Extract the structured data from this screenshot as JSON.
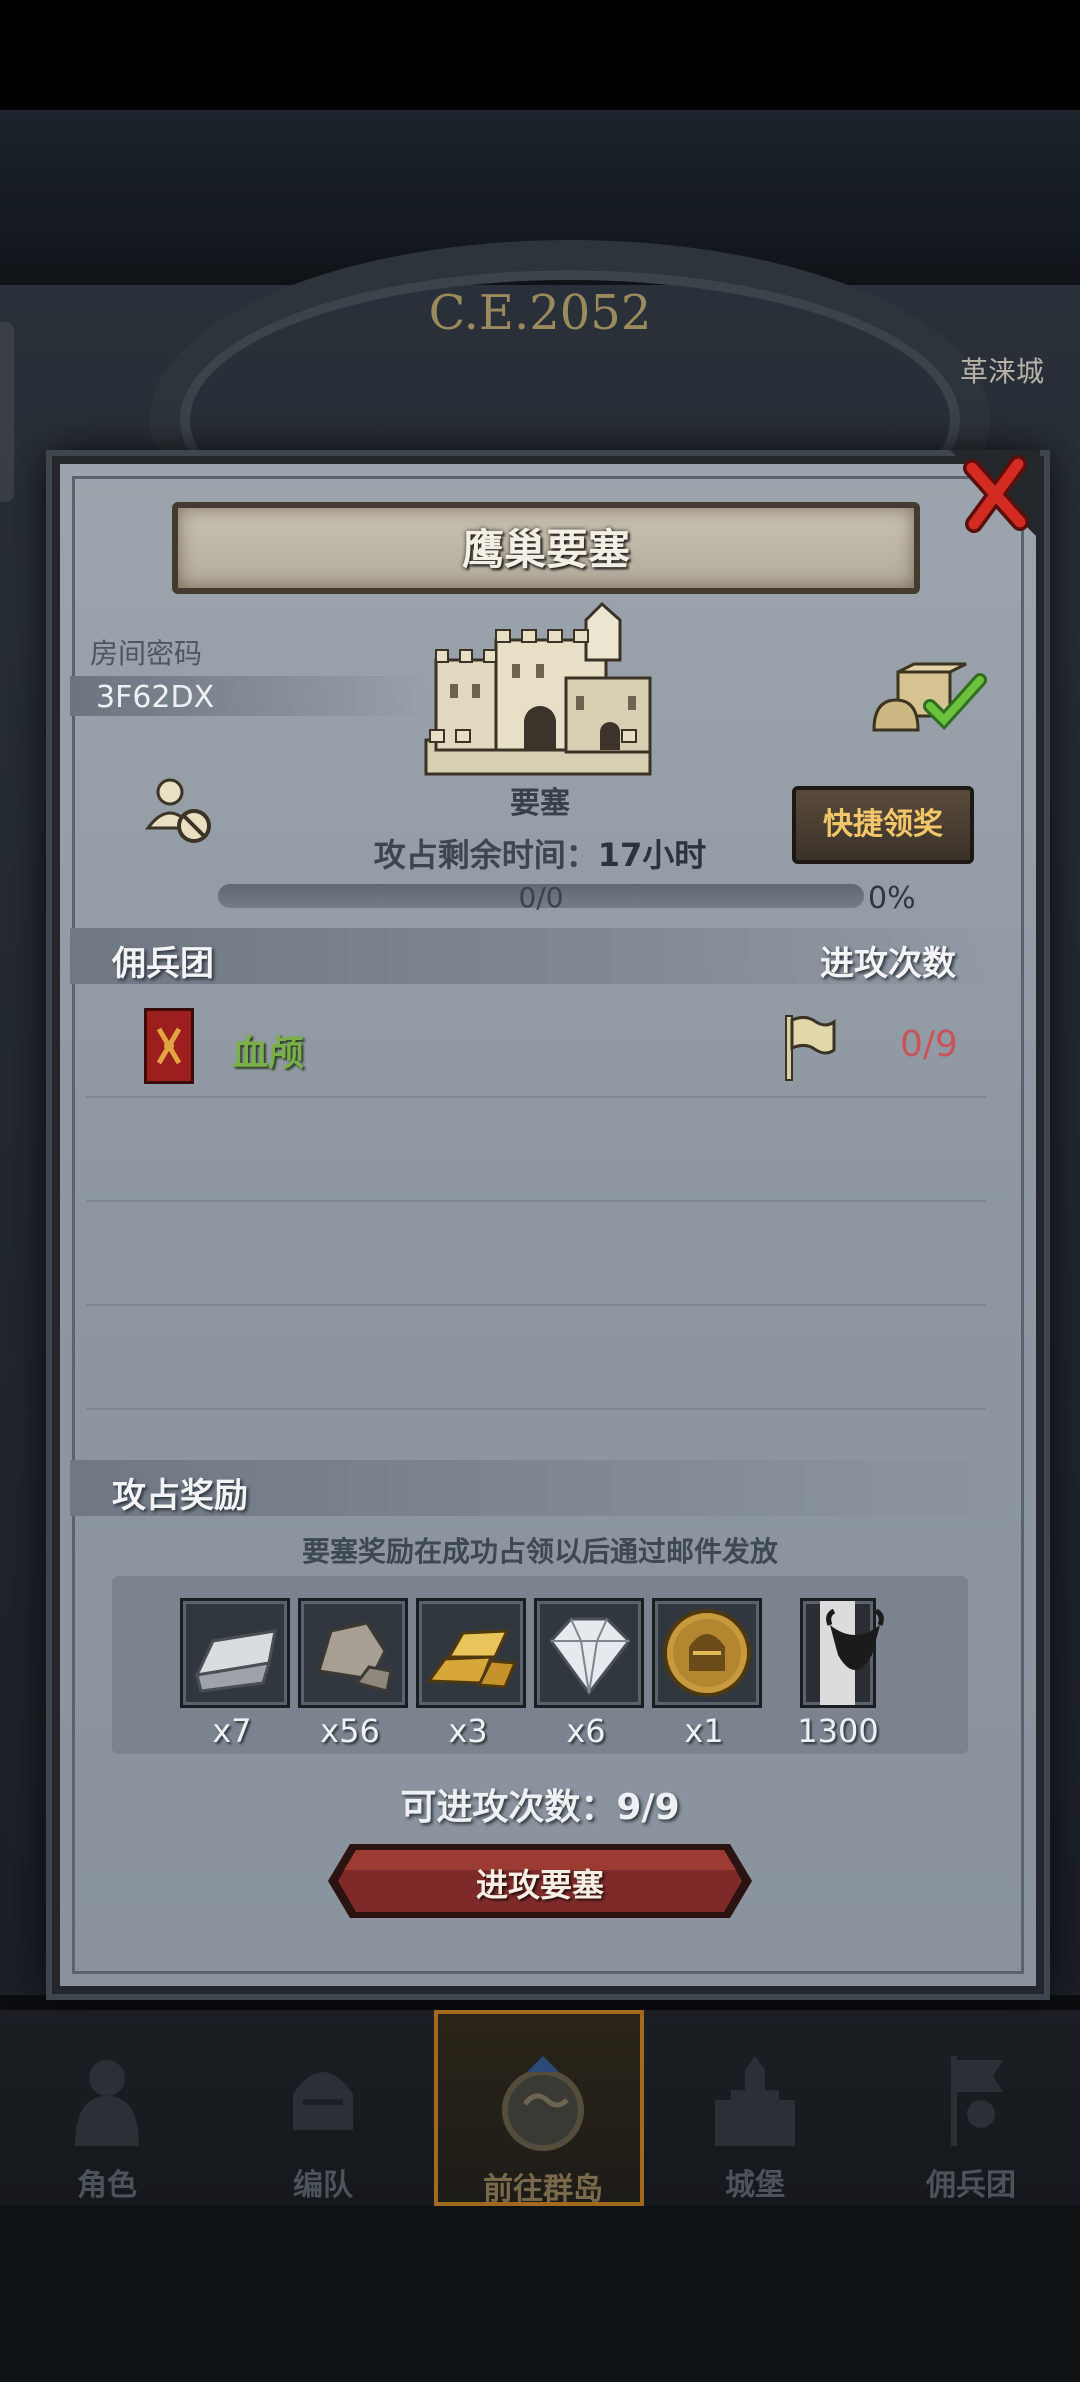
{
  "header": {
    "era": "C.E.2052",
    "city_label": "革涞城"
  },
  "modal": {
    "title": "鹰巢要塞",
    "room_password_label": "房间密码",
    "room_password_value": "3F62DX",
    "fortress_label": "要塞",
    "time_remaining_label": "攻占剩余时间：",
    "time_remaining_value": "17小时",
    "quick_claim_label": "快捷领奖",
    "progress_text": "0/0",
    "progress_percent": "0%",
    "progress_fraction": 0,
    "mercenary_header": "佣兵团",
    "attack_count_header": "进攻次数",
    "mercenaries": [
      {
        "name": "血颅",
        "count": "0/9"
      }
    ],
    "rewards_header": "攻占奖励",
    "rewards_note": "要塞奖励在成功占领以后通过邮件发放",
    "rewards": [
      {
        "icon": "silver-ingot-icon",
        "count": "x7"
      },
      {
        "icon": "stone-ore-icon",
        "count": "x56"
      },
      {
        "icon": "gold-bars-icon",
        "count": "x3"
      },
      {
        "icon": "diamond-icon",
        "count": "x6"
      },
      {
        "icon": "knight-helmet-coin-icon",
        "count": "x1"
      },
      {
        "icon": "bull-emblem-icon",
        "count": "1300"
      }
    ],
    "available_attacks_label": "可进攻次数：9/9",
    "attack_button_label": "进攻要塞"
  },
  "nav": {
    "items": [
      {
        "label": "角色",
        "icon": "knight-icon"
      },
      {
        "label": "编队",
        "icon": "helmet-icon"
      },
      {
        "label": "前往群岛",
        "icon": "globe-icon",
        "active": true
      },
      {
        "label": "城堡",
        "icon": "castle-icon"
      },
      {
        "label": "佣兵团",
        "icon": "flag-knight-icon"
      }
    ]
  },
  "colors": {
    "accent_gold": "#f2c76a",
    "mercenary_green": "#79b04a",
    "count_red": "#c9535a",
    "attack_button": "#7d2a28"
  }
}
